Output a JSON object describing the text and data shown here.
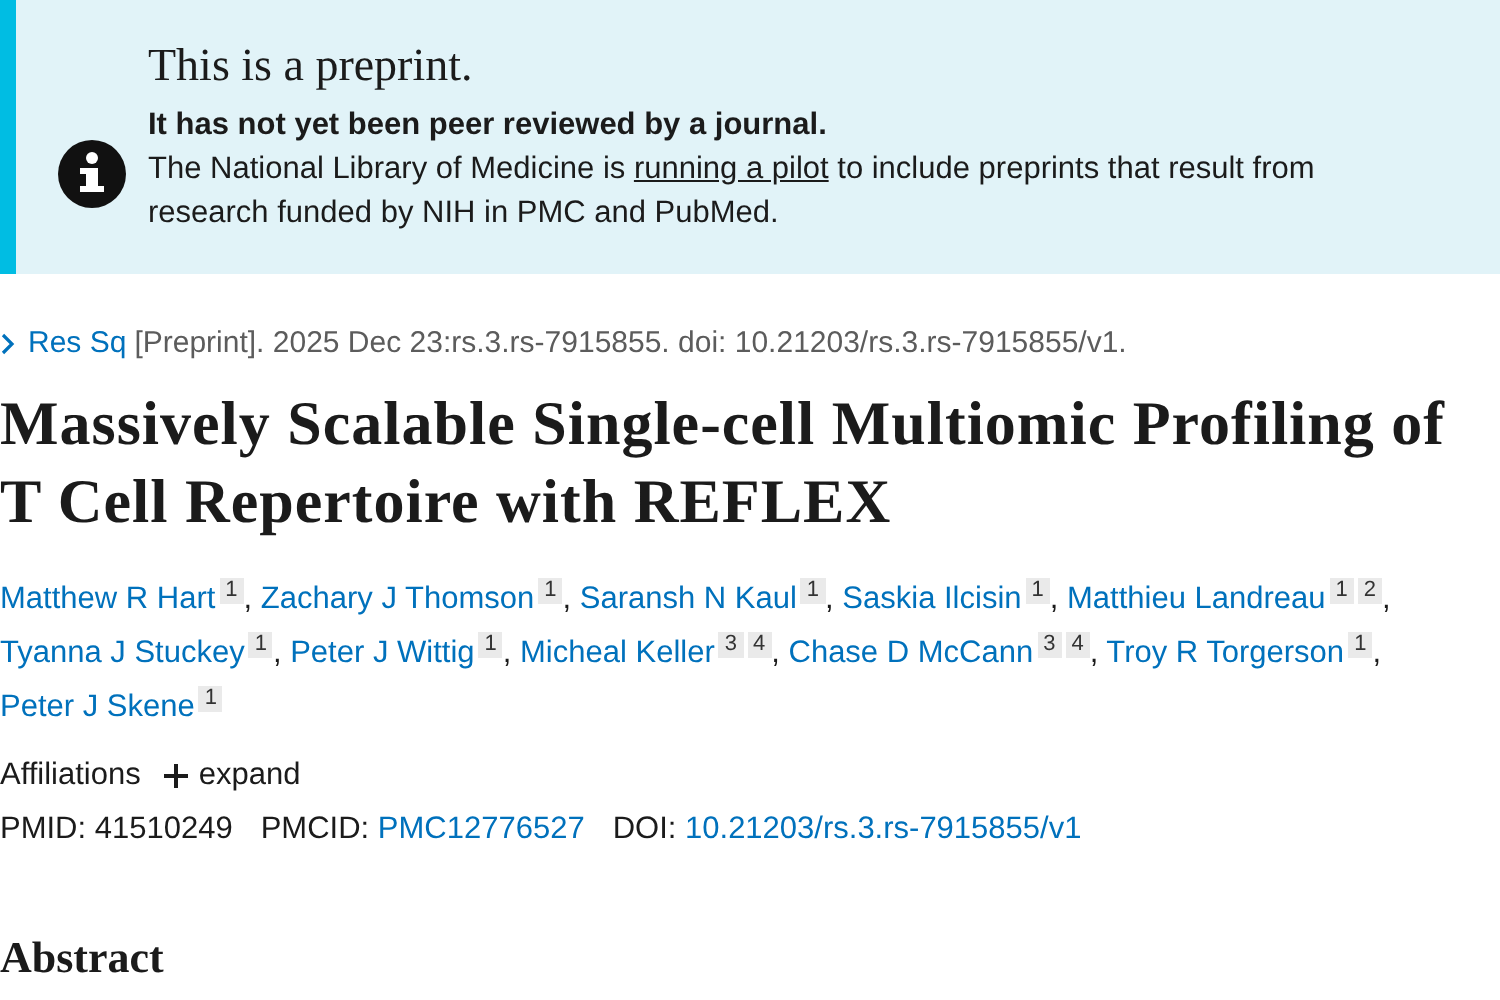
{
  "notice": {
    "title": "This is a preprint.",
    "subtitle": "It has not yet been peer reviewed by a journal.",
    "text_before": "The National Library of Medicine is ",
    "link": "running a pilot",
    "text_after": " to include preprints that result from research funded by NIH in PMC and PubMed."
  },
  "citation": {
    "journal": "Res Sq",
    "text": "[Preprint]. 2025 Dec 23:rs.3.rs-7915855. doi: 10.21203/rs.3.rs-7915855/v1."
  },
  "title": "Massively Scalable Single-cell Multiomic Profiling of T Cell Repertoire with REFLEX",
  "authors": [
    {
      "name": "Matthew R Hart",
      "affiliations": [
        "1"
      ],
      "separator": ","
    },
    {
      "name": "Zachary J Thomson",
      "affiliations": [
        "1"
      ],
      "separator": ","
    },
    {
      "name": "Saransh N Kaul",
      "affiliations": [
        "1"
      ],
      "separator": ","
    },
    {
      "name": "Saskia Ilcisin",
      "affiliations": [
        "1"
      ],
      "separator": ","
    },
    {
      "name": "Matthieu Landreau",
      "affiliations": [
        "1",
        "2"
      ],
      "separator": ","
    },
    {
      "name": "Tyanna J Stuckey",
      "affiliations": [
        "1"
      ],
      "separator": ","
    },
    {
      "name": "Peter J Wittig",
      "affiliations": [
        "1"
      ],
      "separator": ","
    },
    {
      "name": "Micheal Keller",
      "affiliations": [
        "3",
        "4"
      ],
      "separator": ","
    },
    {
      "name": "Chase D McCann",
      "affiliations": [
        "3",
        "4"
      ],
      "separator": ","
    },
    {
      "name": "Troy R Torgerson",
      "affiliations": [
        "1"
      ],
      "separator": ","
    },
    {
      "name": "Peter J Skene",
      "affiliations": [
        "1"
      ]
    }
  ],
  "affiliations": {
    "label": "Affiliations",
    "toggle": "expand",
    "expanded": false
  },
  "identifiers": [
    {
      "label": "PMID:",
      "value": "41510249",
      "link": false
    },
    {
      "label": "PMCID:",
      "value": "PMC12776527",
      "link": true
    },
    {
      "label": "DOI:",
      "value": "10.21203/rs.3.rs-7915855/v1",
      "link": true
    }
  ],
  "abstract": {
    "heading": "Abstract"
  }
}
